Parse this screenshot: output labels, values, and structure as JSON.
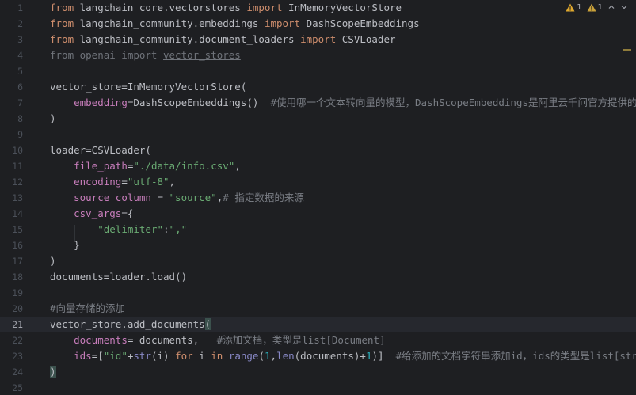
{
  "toolbar": {
    "warning_count_a": "1",
    "warning_count_b": "1"
  },
  "colors": {
    "background": "#1e1f22",
    "keyword": "#cf8e6d",
    "string": "#6aab73",
    "parameter": "#c77dbb",
    "function": "#56a8f5",
    "number": "#2aacb8",
    "comment": "#7a7e85",
    "warning": "#e0a92e"
  },
  "lines": [
    {
      "n": "1",
      "tokens": [
        {
          "t": "from",
          "c": "kw"
        },
        {
          "t": " langchain_core.vectorstores ",
          "c": ""
        },
        {
          "t": "import",
          "c": "kw"
        },
        {
          "t": " InMemoryVectorStore",
          "c": ""
        }
      ]
    },
    {
      "n": "2",
      "tokens": [
        {
          "t": "from",
          "c": "kw"
        },
        {
          "t": " langchain_community.embeddings ",
          "c": ""
        },
        {
          "t": "import",
          "c": "kw"
        },
        {
          "t": " DashScopeEmbeddings",
          "c": ""
        }
      ]
    },
    {
      "n": "3",
      "tokens": [
        {
          "t": "from",
          "c": "kw"
        },
        {
          "t": " langchain_community.document_loaders ",
          "c": ""
        },
        {
          "t": "import",
          "c": "kw"
        },
        {
          "t": " CSVLoader",
          "c": ""
        }
      ]
    },
    {
      "n": "4",
      "tokens": [
        {
          "t": "from openai import ",
          "c": "dim"
        },
        {
          "t": "vector_stores",
          "c": "dim under"
        }
      ]
    },
    {
      "n": "5",
      "tokens": []
    },
    {
      "n": "6",
      "tokens": [
        {
          "t": "vector_store=InMemoryVectorStore(",
          "c": ""
        }
      ]
    },
    {
      "n": "7",
      "tokens": [
        {
          "t": "    ",
          "c": ""
        },
        {
          "t": "embedding",
          "c": "param"
        },
        {
          "t": "=DashScopeEmbeddings()  ",
          "c": ""
        },
        {
          "t": "#使用哪一个文本转向量的模型，DashScopeEmbeddings是阿里云千问官方提供的模型",
          "c": "cmt"
        }
      ]
    },
    {
      "n": "8",
      "tokens": [
        {
          "t": ")",
          "c": ""
        }
      ]
    },
    {
      "n": "9",
      "tokens": []
    },
    {
      "n": "10",
      "tokens": [
        {
          "t": "loader=CSVLoader(",
          "c": ""
        }
      ]
    },
    {
      "n": "11",
      "tokens": [
        {
          "t": "    ",
          "c": ""
        },
        {
          "t": "file_path",
          "c": "param"
        },
        {
          "t": "=",
          "c": ""
        },
        {
          "t": "\"./data/info.csv\"",
          "c": "str"
        },
        {
          "t": ",",
          "c": ""
        }
      ]
    },
    {
      "n": "12",
      "tokens": [
        {
          "t": "    ",
          "c": ""
        },
        {
          "t": "encoding",
          "c": "param"
        },
        {
          "t": "=",
          "c": ""
        },
        {
          "t": "\"utf-8\"",
          "c": "str"
        },
        {
          "t": ",",
          "c": ""
        }
      ]
    },
    {
      "n": "13",
      "tokens": [
        {
          "t": "    ",
          "c": ""
        },
        {
          "t": "source_column",
          "c": "param"
        },
        {
          "t": " = ",
          "c": ""
        },
        {
          "t": "\"source\"",
          "c": "str"
        },
        {
          "t": ",",
          "c": ""
        },
        {
          "t": "# 指定数据的来源",
          "c": "cmt"
        }
      ]
    },
    {
      "n": "14",
      "tokens": [
        {
          "t": "    ",
          "c": ""
        },
        {
          "t": "csv_args",
          "c": "param"
        },
        {
          "t": "={",
          "c": ""
        }
      ]
    },
    {
      "n": "15",
      "tokens": [
        {
          "t": "        ",
          "c": ""
        },
        {
          "t": "\"delimiter\"",
          "c": "str"
        },
        {
          "t": ":",
          "c": ""
        },
        {
          "t": "\",\"",
          "c": "str"
        }
      ]
    },
    {
      "n": "16",
      "tokens": [
        {
          "t": "    }",
          "c": ""
        }
      ]
    },
    {
      "n": "17",
      "tokens": [
        {
          "t": ")",
          "c": ""
        }
      ]
    },
    {
      "n": "18",
      "tokens": [
        {
          "t": "documents=loader.load()",
          "c": ""
        }
      ]
    },
    {
      "n": "19",
      "tokens": []
    },
    {
      "n": "20",
      "tokens": [
        {
          "t": "#向量存储的添加",
          "c": "cmt"
        }
      ]
    },
    {
      "n": "21",
      "current": true,
      "tokens": [
        {
          "t": "vector_store.add_documents",
          "c": ""
        },
        {
          "t": "(",
          "c": "brace-hl"
        }
      ]
    },
    {
      "n": "22",
      "tokens": [
        {
          "t": "    ",
          "c": ""
        },
        {
          "t": "documents",
          "c": "param"
        },
        {
          "t": "= documents,   ",
          "c": ""
        },
        {
          "t": "#添加文档，类型是list[Document]",
          "c": "cmt"
        }
      ]
    },
    {
      "n": "23",
      "tokens": [
        {
          "t": "    ",
          "c": ""
        },
        {
          "t": "ids",
          "c": "param"
        },
        {
          "t": "=[",
          "c": ""
        },
        {
          "t": "\"id\"",
          "c": "str"
        },
        {
          "t": "+",
          "c": ""
        },
        {
          "t": "str",
          "c": "builtin"
        },
        {
          "t": "(i) ",
          "c": ""
        },
        {
          "t": "for",
          "c": "kw"
        },
        {
          "t": " i ",
          "c": ""
        },
        {
          "t": "in",
          "c": "kw"
        },
        {
          "t": " ",
          "c": ""
        },
        {
          "t": "range",
          "c": "builtin"
        },
        {
          "t": "(",
          "c": ""
        },
        {
          "t": "1",
          "c": "num"
        },
        {
          "t": ",",
          "c": ""
        },
        {
          "t": "len",
          "c": "builtin"
        },
        {
          "t": "(documents)+",
          "c": ""
        },
        {
          "t": "1",
          "c": "num"
        },
        {
          "t": ")]  ",
          "c": ""
        },
        {
          "t": "#给添加的文档字符串添加id，ids的类型是list[str]",
          "c": "cmt"
        }
      ]
    },
    {
      "n": "24",
      "tokens": [
        {
          "t": ")",
          "c": "brace-hl"
        }
      ]
    },
    {
      "n": "25",
      "tokens": []
    }
  ]
}
